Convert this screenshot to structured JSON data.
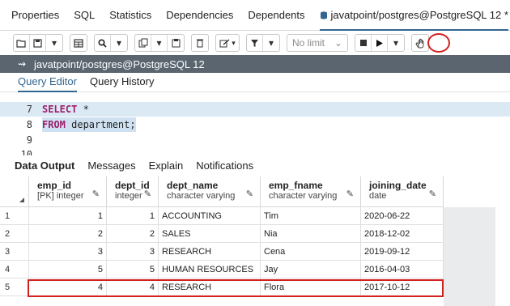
{
  "top_tabs": [
    {
      "label": "Properties",
      "active": false
    },
    {
      "label": "SQL",
      "active": false
    },
    {
      "label": "Statistics",
      "active": false
    },
    {
      "label": "Dependencies",
      "active": false
    },
    {
      "label": "Dependents",
      "active": false
    },
    {
      "label": "javatpoint/postgres@PostgreSQL 12 *",
      "active": true
    }
  ],
  "toolbar": {
    "limit_label": "No limit",
    "icons": [
      "open-file-icon",
      "save-icon",
      "chevron-down-icon",
      "table-icon",
      "search-icon",
      "copy-icon",
      "paste-icon",
      "delete-icon",
      "edit-icon",
      "filter-icon",
      "stop-icon",
      "play-icon",
      "hand-icon"
    ]
  },
  "title_bar": {
    "label": "javatpoint/postgres@PostgreSQL 12"
  },
  "query_tabs": [
    {
      "label": "Query Editor",
      "active": true
    },
    {
      "label": "Query History",
      "active": false
    }
  ],
  "editor": {
    "lines": [
      {
        "number": "7",
        "keyword": "SELECT",
        "rest": " *"
      },
      {
        "number": "8",
        "keyword": "FROM",
        "rest": " department;"
      },
      {
        "number": "9",
        "keyword": "",
        "rest": ""
      },
      {
        "number": "10",
        "keyword": "",
        "rest": ""
      }
    ]
  },
  "output_tabs": [
    {
      "label": "Data Output",
      "active": true
    },
    {
      "label": "Messages",
      "active": false
    },
    {
      "label": "Explain",
      "active": false
    },
    {
      "label": "Notifications",
      "active": false
    }
  ],
  "grid": {
    "columns": [
      {
        "name": "emp_id",
        "type": "[PK] integer"
      },
      {
        "name": "dept_id",
        "type": "integer"
      },
      {
        "name": "dept_name",
        "type": "character varying"
      },
      {
        "name": "emp_fname",
        "type": "character varying"
      },
      {
        "name": "joining_date",
        "type": "date"
      }
    ],
    "rows": [
      {
        "n": "1",
        "emp_id": "1",
        "dept_id": "1",
        "dept_name": "ACCOUNTING",
        "emp_fname": "Tim",
        "joining_date": "2020-06-22"
      },
      {
        "n": "2",
        "emp_id": "2",
        "dept_id": "2",
        "dept_name": "SALES",
        "emp_fname": "Nia",
        "joining_date": "2018-12-02"
      },
      {
        "n": "3",
        "emp_id": "3",
        "dept_id": "3",
        "dept_name": "RESEARCH",
        "emp_fname": "Cena",
        "joining_date": "2019-09-12"
      },
      {
        "n": "4",
        "emp_id": "5",
        "dept_id": "5",
        "dept_name": "HUMAN RESOURCES",
        "emp_fname": "Jay",
        "joining_date": "2016-04-03"
      },
      {
        "n": "5",
        "emp_id": "4",
        "dept_id": "4",
        "dept_name": "RESEARCH",
        "emp_fname": "Flora",
        "joining_date": "2017-10-12"
      }
    ]
  },
  "colors": {
    "accent": "#326690",
    "title_bar": "#5a6570",
    "highlight": "#d12020",
    "keyword": "#9c1f6a"
  }
}
